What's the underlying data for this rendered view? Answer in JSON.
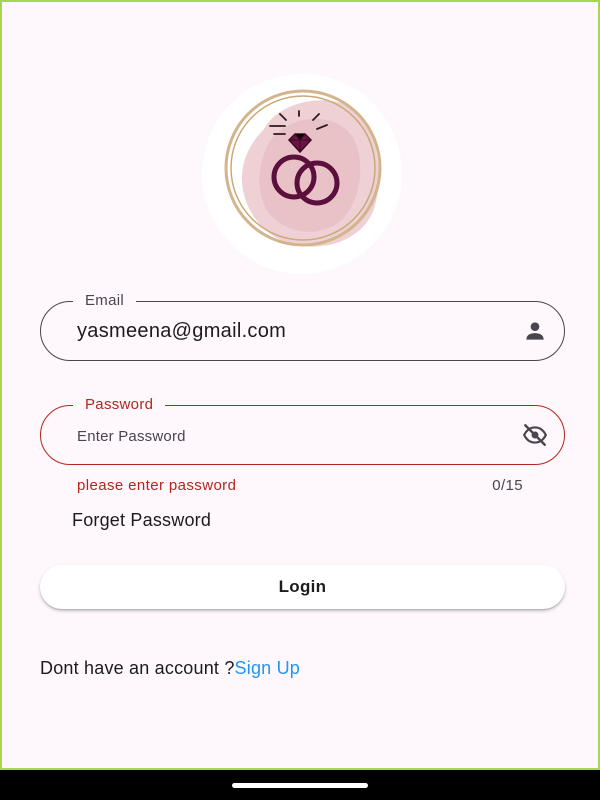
{
  "logo": {
    "icon": "wedding-rings-logo",
    "colors": {
      "ring": "#5b0f3c",
      "gold": "#c9a978",
      "splash": "#e9c3c8"
    }
  },
  "email": {
    "label": "Email",
    "value": "yasmeena@gmail.com",
    "icon": "person-icon"
  },
  "password": {
    "label": "Password",
    "placeholder": "Enter Password",
    "icon": "eye-off-icon",
    "error": "please enter password",
    "counter": "0/15"
  },
  "forget_password": "Forget Password",
  "login_button": "Login",
  "signup": {
    "prompt": "Dont have an account ?",
    "link": "Sign Up"
  },
  "colors": {
    "error": "#b3261e",
    "link": "#2196f3",
    "background": "#fef7fc"
  }
}
